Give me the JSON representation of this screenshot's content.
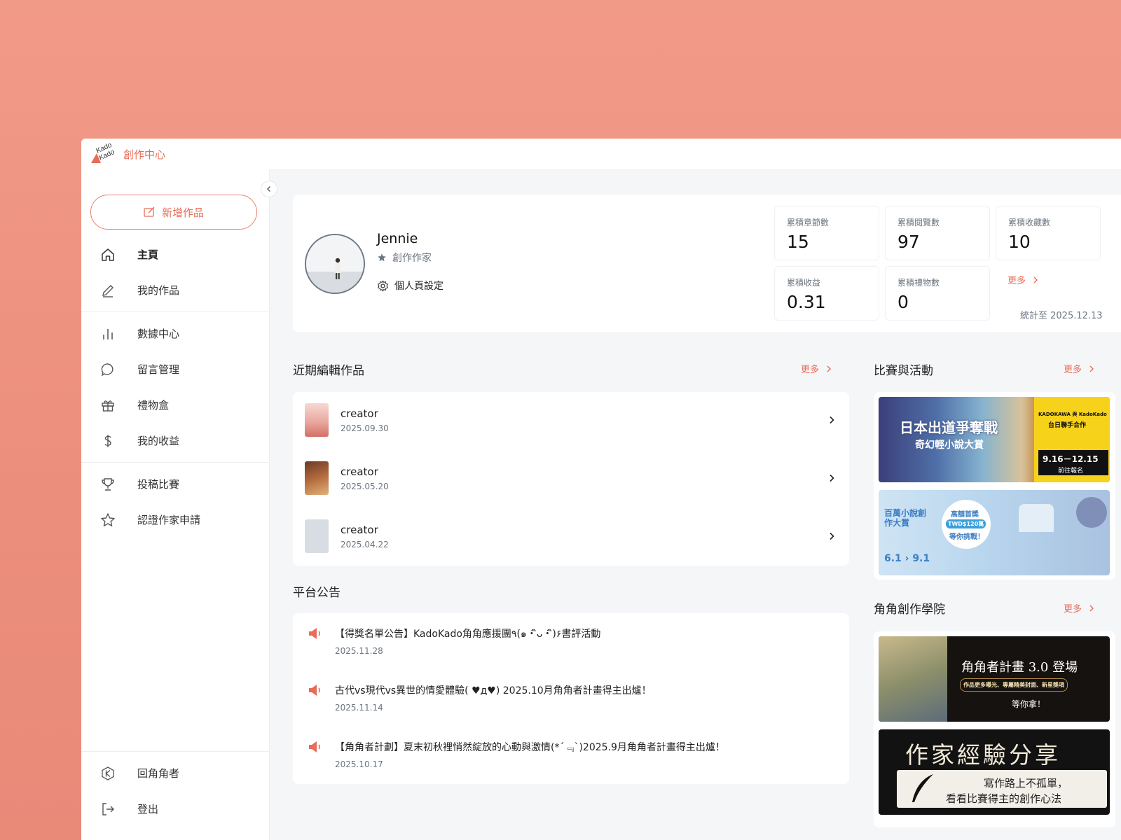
{
  "app": {
    "title": "創作中心",
    "logo_text": "Kado Kado"
  },
  "sidebar": {
    "new_work": "新增作品",
    "items": [
      {
        "label": "主頁",
        "icon": "home-icon"
      },
      {
        "label": "我的作品",
        "icon": "pencil-icon"
      },
      {
        "label": "數據中心",
        "icon": "bar-chart-icon"
      },
      {
        "label": "留言管理",
        "icon": "comment-icon"
      },
      {
        "label": "禮物盒",
        "icon": "gift-icon"
      },
      {
        "label": "我的收益",
        "icon": "dollar-icon"
      },
      {
        "label": "投稿比賽",
        "icon": "trophy-icon"
      },
      {
        "label": "認證作家申請",
        "icon": "star-icon"
      }
    ],
    "bottom_items": [
      {
        "label": "回角角者",
        "icon": "k-badge-icon"
      },
      {
        "label": "登出",
        "icon": "logout-icon"
      }
    ]
  },
  "profile": {
    "name": "Jennie",
    "role": "創作作家",
    "settings": "個人頁設定"
  },
  "stats": [
    {
      "label": "累積章節數",
      "value": "15"
    },
    {
      "label": "累積閱覽數",
      "value": "97"
    },
    {
      "label": "累積收藏數",
      "value": "10"
    },
    {
      "label": "累積收益",
      "value": "0.31"
    },
    {
      "label": "累積禮物數",
      "value": "0"
    }
  ],
  "stats_more": "更多",
  "stats_updated": "統計至 2025.12.13",
  "recent": {
    "title": "近期編輯作品",
    "more": "更多",
    "items": [
      {
        "title": "creator",
        "date": "2025.09.30"
      },
      {
        "title": "creator",
        "date": "2025.05.20"
      },
      {
        "title": "creator",
        "date": "2025.04.22"
      }
    ]
  },
  "announcements": {
    "title": "平台公告",
    "items": [
      {
        "text": "【得獎名單公告】KadoKado角角應援團٩(๑・ิᴗ・ิ)۶書評活動",
        "date": "2025.11.28"
      },
      {
        "text": "古代vs現代vs異世的情愛體驗( ♥д♥) 2025.10月角角者計畫得主出爐！",
        "date": "2025.11.14"
      },
      {
        "text": "【角角者計劃】夏末初秋裡悄然綻放的心動與激情(*´﹃`)2025.9月角角者計畫得主出爐！",
        "date": "2025.10.17"
      }
    ]
  },
  "contests": {
    "title": "比賽與活動",
    "more": "更多",
    "banner1": {
      "headline": "日本出道爭奪戰",
      "sub": "奇幻輕小說大賞",
      "side1": "KADOKAWA 與 KadoKado",
      "side2": "台日聯手合作",
      "dates": "9.16－12.15",
      "cta": "前往報名"
    },
    "banner2": {
      "headline": "百萬小說創作大賞",
      "prize": "高額首獎",
      "prize_amount": "TWD$120萬",
      "challenge": "等你挑戰！",
      "dates": "6.1 › 9.1"
    }
  },
  "academy": {
    "title": "角角創作學院",
    "more": "更多",
    "banner1": {
      "headline": "角角者計畫 3.0 登場",
      "sub": "作品更多曝光、專屬精美封面、新星獎項",
      "cta": "等你拿！"
    },
    "banner2": {
      "headline": "作家經驗分享",
      "line1": "寫作路上不孤單，",
      "line2": "看看比賽得主的創作心法"
    }
  },
  "colors": {
    "accent": "#e86c57",
    "background": "#f4f6f8"
  }
}
